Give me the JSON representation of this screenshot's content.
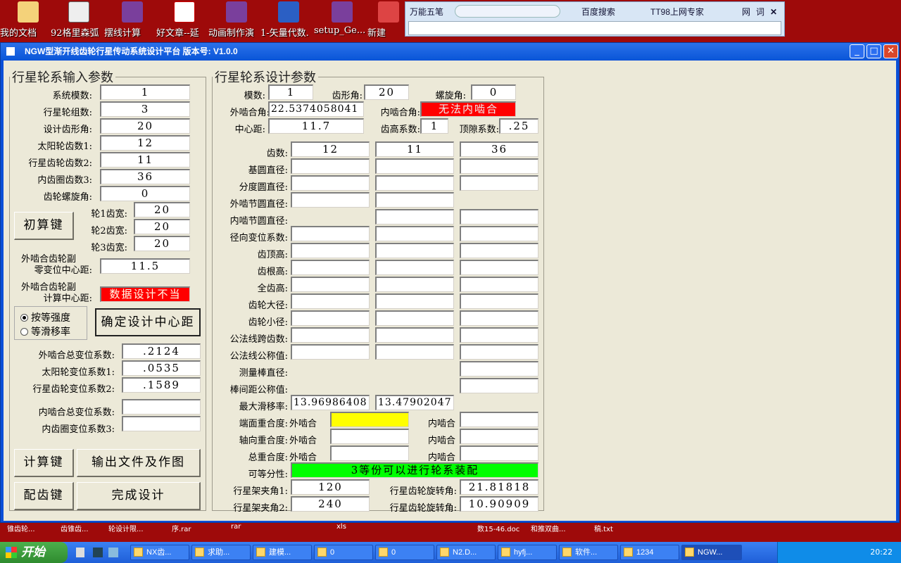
{
  "desktop": {
    "icons": [
      "我的文档",
      "92格里森弧",
      "摆线计算",
      "好文章--延",
      "动画制作演",
      "1-矢量代数.",
      "setup_Ge...",
      "新建"
    ],
    "bottom_labels": [
      "锥齿轮...",
      "齿锥齿...",
      "轮设计限...",
      "序.rar",
      "rar",
      "xls",
      "数15-46.doc",
      "和推双曲...",
      "稿.txt"
    ]
  },
  "ime": {
    "name": "万能五笔",
    "search": "百度搜索",
    "expert": "TT98上网专家",
    "word_btn": "网",
    "dict_btn": "词",
    "close": "✕"
  },
  "window": {
    "title": "NGW型渐开线齿轮行星传动系统设计平台   版本号: V1.0.0",
    "min": "_",
    "max": "□",
    "close": "✕"
  },
  "input_panel": {
    "legend": "行星轮系输入参数",
    "fields": [
      {
        "label": "系统模数:",
        "value": "1"
      },
      {
        "label": "行星轮组数:",
        "value": "3"
      },
      {
        "label": "设计齿形角:",
        "value": "20"
      },
      {
        "label": "太阳轮齿数1:",
        "value": "12"
      },
      {
        "label": "行星齿轮齿数2:",
        "value": "11"
      },
      {
        "label": "内齿圈齿数3:",
        "value": "36"
      },
      {
        "label": "齿轮螺旋角:",
        "value": "0"
      }
    ],
    "init_btn": "初算键",
    "widths": [
      {
        "label": "轮1齿宽:",
        "value": "20"
      },
      {
        "label": "轮2齿宽:",
        "value": "20"
      },
      {
        "label": "轮3齿宽:",
        "value": "20"
      }
    ],
    "zero_center_label_1": "外啮合齿轮副",
    "zero_center_label_2": "零变位中心距:",
    "zero_center_value": "11.5",
    "calc_center_label_1": "外啮合齿轮副",
    "calc_center_label_2": "计算中心距:",
    "calc_center_value": "数据设计不当",
    "radio_strength": "按等强度",
    "radio_slip": "等滑移率",
    "confirm_btn": "确定设计中心距",
    "shift": [
      {
        "label": "外啮合总变位系数:",
        "value": ".2124"
      },
      {
        "label": "太阳轮变位系数1:",
        "value": ".0535"
      },
      {
        "label": "行星齿轮变位系数2:",
        "value": ".1589"
      }
    ],
    "inner_shift": [
      {
        "label": "内啮合总变位系数:",
        "value": ""
      },
      {
        "label": "内齿圈变位系数3:",
        "value": ""
      }
    ],
    "calc_btn": "计算键",
    "output_btn": "输出文件及作图",
    "match_btn": "配齿键",
    "finish_btn": "完成设计"
  },
  "design_panel": {
    "legend": "行星轮系设计参数",
    "module_label": "模数:",
    "module_value": "1",
    "tooth_angle_label": "齿形角:",
    "tooth_angle_value": "20",
    "helix_label": "螺旋角:",
    "helix_value": "0",
    "ext_mesh_label": "外啮合角:",
    "ext_mesh_value": "22.5374058041",
    "int_mesh_label": "内啮合角:",
    "int_mesh_value": "无法内啮合",
    "center_label": "中心距:",
    "center_value": "11.7",
    "addendum_label": "齿高系数:",
    "addendum_value": "1",
    "clearance_label": "顶隙系数:",
    "clearance_value": ".25",
    "teeth_label": "齿数:",
    "teeth": [
      "12",
      "11",
      "36"
    ],
    "rows": [
      "基圆直径:",
      "分度圆直径:",
      "外啮节圆直径:",
      "内啮节圆直径:",
      "径向变位系数:",
      "齿顶高:",
      "齿根高:",
      "全齿高:",
      "齿轮大径:",
      "齿轮小径:",
      "公法线跨齿数:",
      "公法线公称值:",
      "测量棒直径:",
      "棒间距公称值:"
    ],
    "max_slip_label": "最大滑移率:",
    "max_slip": [
      "13.96986408",
      "13.47902047"
    ],
    "transverse_label": "端面重合度:",
    "axial_label": "轴向重合度:",
    "total_label": "总重合度:",
    "ext_label": "外啮合",
    "int_label": "内啮合",
    "divisible_label": "可等分性:",
    "divisible_value": "3等份可以进行轮系装配",
    "carrier1_label": "行星架夹角1:",
    "carrier1_value": "120",
    "carrier2_label": "行星架夹角2:",
    "carrier2_value": "240",
    "rot1_label": "行星齿轮旋转角:",
    "rot1_value": "21.81818",
    "rot2_label": "行星齿轮旋转角:",
    "rot2_value": "10.90909"
  },
  "taskbar": {
    "start": "开始",
    "tasks": [
      "NX齿...",
      "求助...",
      "建模...",
      "0",
      "0",
      "N2.D...",
      "hyfj...",
      "软件...",
      "1234",
      "NGW..."
    ],
    "time": "20:22"
  },
  "colors": {
    "desktop": "#9e0a0a",
    "titlebar": "#0a56d8",
    "error": "#ff0000",
    "ok": "#00ff00",
    "highlight": "#ffff00"
  }
}
